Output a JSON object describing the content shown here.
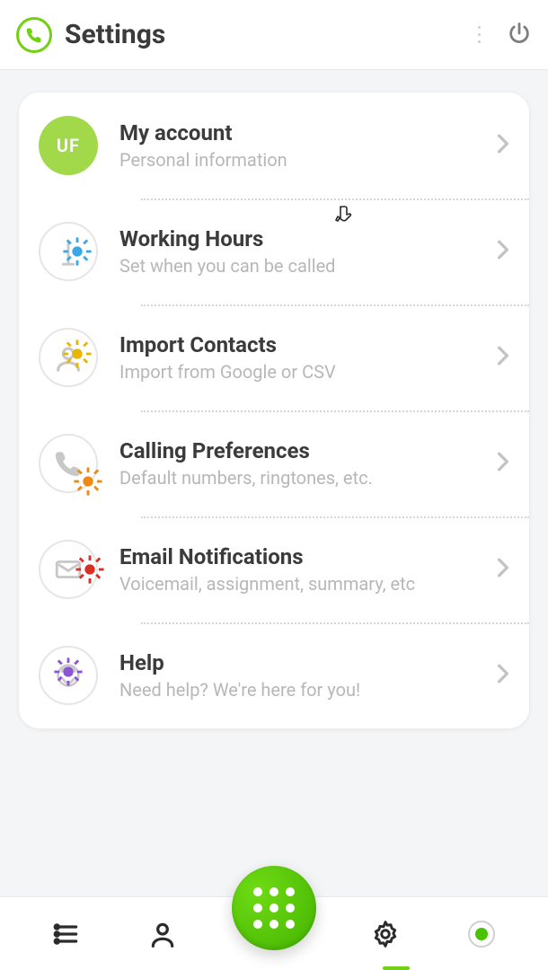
{
  "header": {
    "title": "Settings"
  },
  "account": {
    "initials": "UF"
  },
  "rows": {
    "account": {
      "title": "My account",
      "subtitle": "Personal information"
    },
    "hours": {
      "title": "Working Hours",
      "subtitle": "Set when you can be called"
    },
    "import": {
      "title": "Import Contacts",
      "subtitle": "Import from Google or CSV"
    },
    "calling": {
      "title": "Calling Preferences",
      "subtitle": "Default numbers, ringtones, etc."
    },
    "email": {
      "title": "Email Notifications",
      "subtitle": "Voicemail, assignment, summary, etc"
    },
    "help": {
      "title": "Help",
      "subtitle": "Need help? We're here for you!"
    }
  },
  "colors": {
    "accent": "#73cf11",
    "fab_gradient_a": "#6edb14",
    "fab_gradient_b": "#44b300",
    "status_online": "#49c300"
  }
}
